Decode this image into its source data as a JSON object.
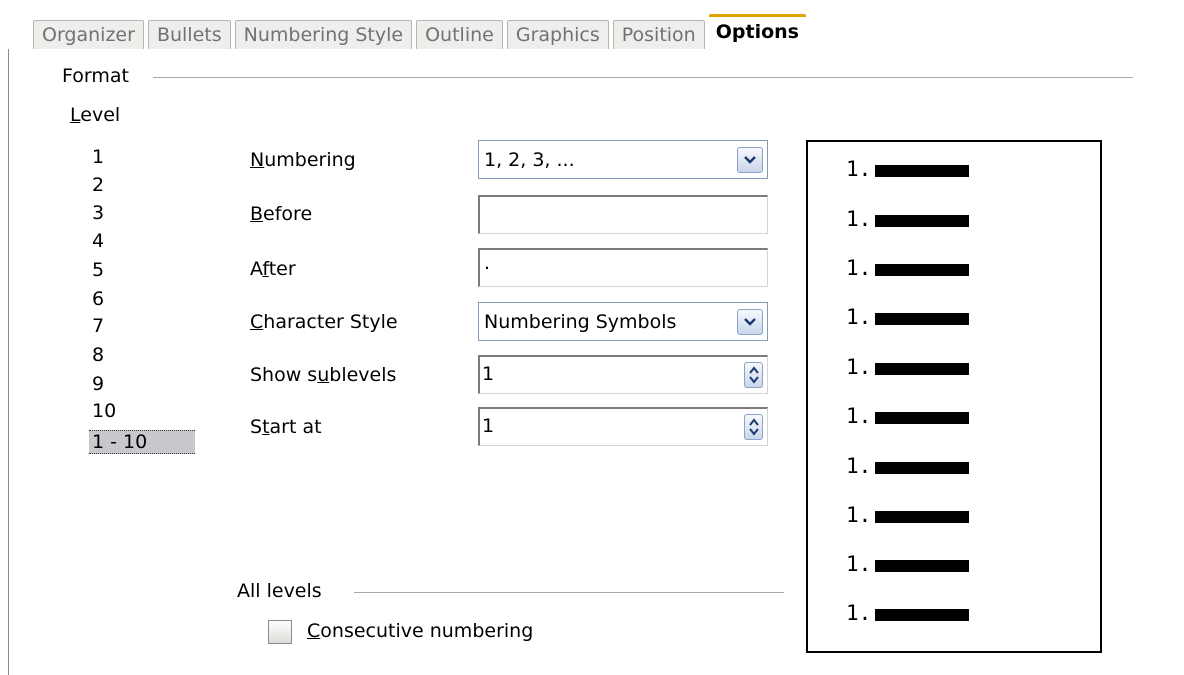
{
  "tabs": [
    {
      "label": "Organizer",
      "active": false
    },
    {
      "label": "Bullets",
      "active": false
    },
    {
      "label": "Numbering Style",
      "active": false
    },
    {
      "label": "Outline",
      "active": false
    },
    {
      "label": "Graphics",
      "active": false
    },
    {
      "label": "Position",
      "active": false
    },
    {
      "label": "Options",
      "active": true
    }
  ],
  "format": {
    "group_label": "Format",
    "level_label_mnemonic": "L",
    "level_label_rest": "evel",
    "levels": [
      "1",
      "2",
      "3",
      "4",
      "5",
      "6",
      "7",
      "8",
      "9",
      "10",
      "1 - 10"
    ],
    "selected_level": "1 - 10"
  },
  "fields": {
    "numbering": {
      "label_mnemonic": "N",
      "label_rest": "umbering",
      "value": "1, 2, 3, ..."
    },
    "before": {
      "label_mnemonic": "B",
      "label_rest": "efore",
      "value": ""
    },
    "after": {
      "label_pre": "A",
      "label_mnemonic": "f",
      "label_rest": "ter",
      "value": "."
    },
    "character_style": {
      "label_mnemonic": "C",
      "label_rest": "haracter Style",
      "value": "Numbering Symbols"
    },
    "show_sublevels": {
      "label_pre": "Show s",
      "label_mnemonic": "u",
      "label_rest": "blevels",
      "value": "1"
    },
    "start_at": {
      "label_pre": "S",
      "label_mnemonic": "t",
      "label_rest": "art at",
      "value": "1"
    }
  },
  "all_levels": {
    "group_label": "All levels",
    "consecutive_mnemonic": "C",
    "consecutive_rest": "onsecutive numbering",
    "consecutive_checked": false
  },
  "preview": {
    "rows": [
      "1.",
      "1.",
      "1.",
      "1.",
      "1.",
      "1.",
      "1.",
      "1.",
      "1.",
      "1."
    ]
  },
  "colors": {
    "active_tab_accent": "#e5a100",
    "selected_level_bg": "#c8c8cd"
  }
}
